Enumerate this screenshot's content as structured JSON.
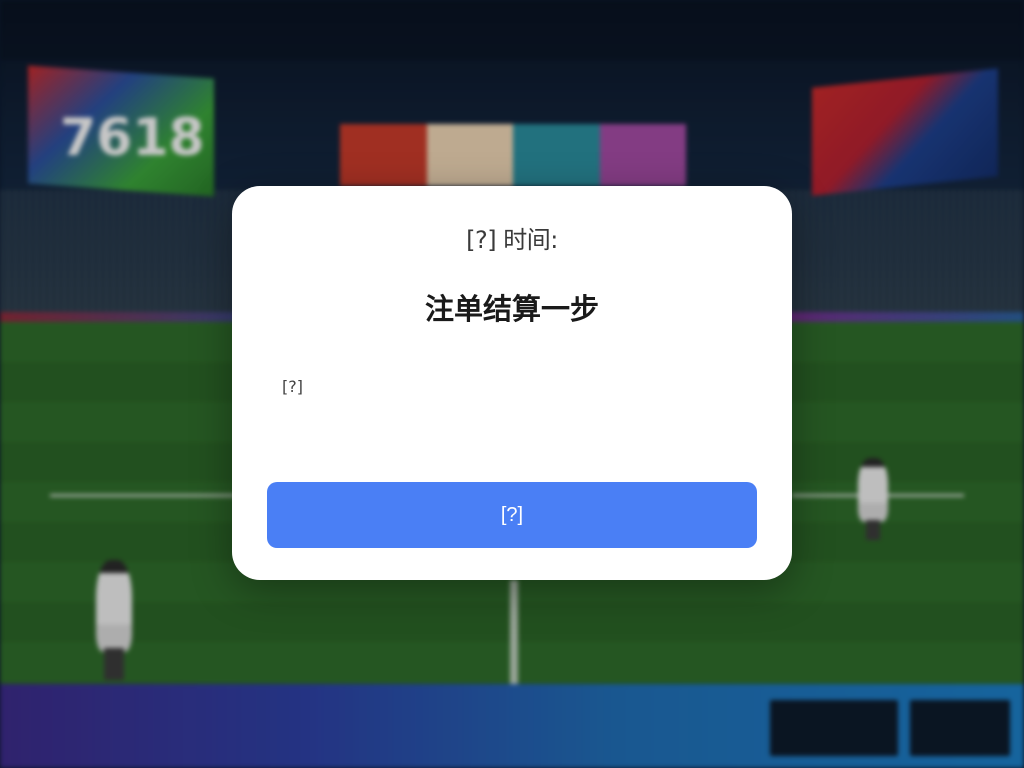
{
  "background": {
    "scoreboard_left_text": "7618",
    "colors": {
      "pitch": "#2e6a2a",
      "sky": "#0a1424",
      "bottom_ad": "#2c3fa0"
    }
  },
  "modal": {
    "subtitle": "[?] 时间:",
    "title": "注单结算一步",
    "body": "[?]",
    "button_label": "[?]",
    "colors": {
      "button": "#4a7ff5",
      "background": "#ffffff"
    }
  }
}
